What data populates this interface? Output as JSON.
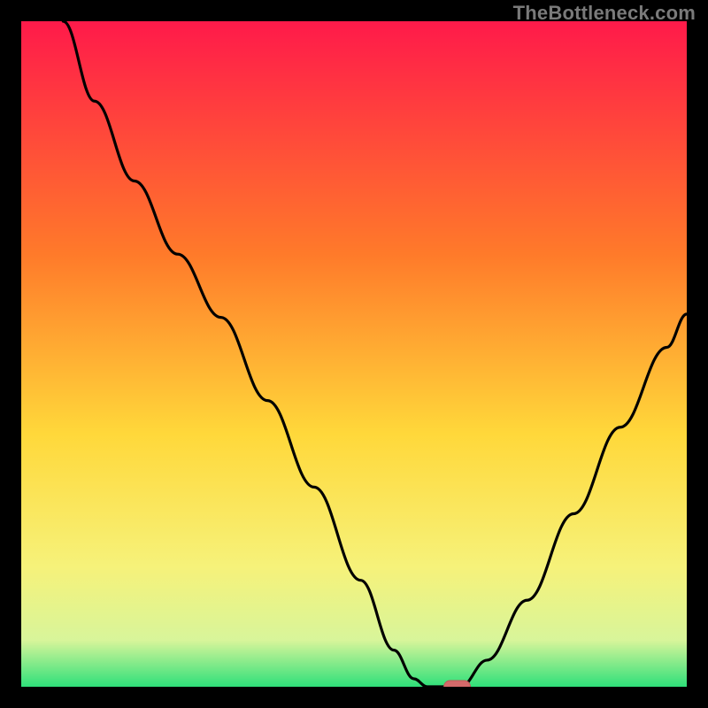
{
  "watermark": "TheBottleneck.com",
  "colors": {
    "frame": "#000000",
    "curve": "#000000",
    "marker_fill": "#d46a6a",
    "marker_stroke": "#c05858",
    "gradient": {
      "top": "#ff1a4a",
      "mid1": "#ff7a2a",
      "mid2": "#ffd83a",
      "low1": "#f6f27a",
      "low2": "#d8f59a",
      "bottom": "#2fe07a"
    }
  },
  "chart_data": {
    "type": "line",
    "series": [
      {
        "name": "bottleneck-curve",
        "points": [
          {
            "x": 0.063,
            "y": 1.0
          },
          {
            "x": 0.11,
            "y": 0.88
          },
          {
            "x": 0.17,
            "y": 0.76
          },
          {
            "x": 0.235,
            "y": 0.65
          },
          {
            "x": 0.3,
            "y": 0.555
          },
          {
            "x": 0.37,
            "y": 0.43
          },
          {
            "x": 0.44,
            "y": 0.3
          },
          {
            "x": 0.51,
            "y": 0.16
          },
          {
            "x": 0.56,
            "y": 0.055
          },
          {
            "x": 0.59,
            "y": 0.012
          },
          {
            "x": 0.61,
            "y": 0.0
          },
          {
            "x": 0.66,
            "y": 0.0
          },
          {
            "x": 0.7,
            "y": 0.04
          },
          {
            "x": 0.76,
            "y": 0.13
          },
          {
            "x": 0.83,
            "y": 0.26
          },
          {
            "x": 0.9,
            "y": 0.39
          },
          {
            "x": 0.97,
            "y": 0.51
          },
          {
            "x": 1.0,
            "y": 0.56
          }
        ]
      }
    ],
    "optimum_marker": {
      "x": 0.655,
      "y": 0.0
    },
    "plot_area_fraction": {
      "left": 0.03,
      "right": 0.97,
      "top": 0.03,
      "bottom": 0.97
    },
    "title": "",
    "xlabel": "",
    "ylabel": "",
    "xlim": [
      0,
      1
    ],
    "ylim": [
      0,
      1
    ]
  }
}
